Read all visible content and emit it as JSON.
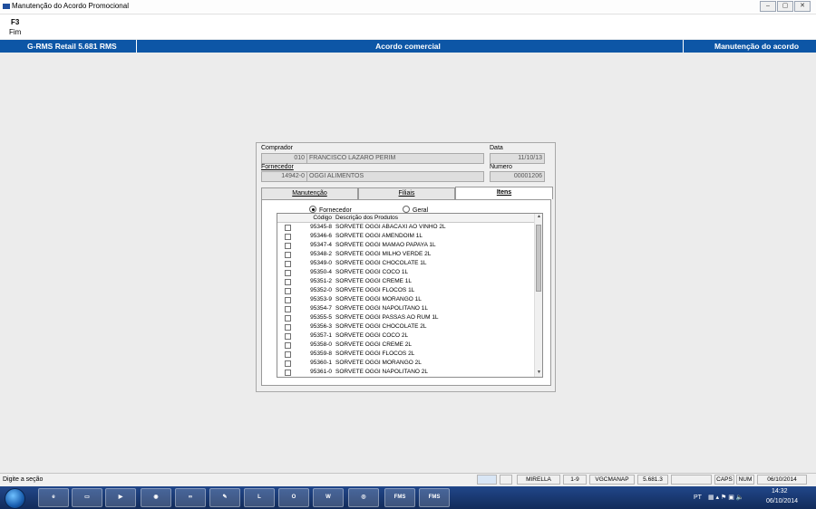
{
  "window": {
    "title": "Manutenção do Acordo Promocional",
    "controls": [
      "‒",
      "▢",
      "✕"
    ]
  },
  "toolbar": {
    "key": "F3",
    "action": "Fim"
  },
  "header": {
    "left": "G-RMS Retail 5.681 RMS",
    "center": "Acordo comercial",
    "right": "Manutenção do acordo"
  },
  "form": {
    "comprador_label": "Comprador",
    "comprador_code": "010",
    "comprador_name": "FRANCISCO LAZARO PERIM",
    "data_label": "Data",
    "data_value": "11/10/13",
    "fornecedor_label": "Fornecedor",
    "fornecedor_code": "14942-0",
    "fornecedor_name": "OGGI ALIMENTOS",
    "numero_label": "Numero",
    "numero_value": "00001206"
  },
  "tabs": [
    {
      "label": "Manutenção",
      "active": false
    },
    {
      "label": "Filiais",
      "active": false
    },
    {
      "label": "Itens",
      "active": true
    }
  ],
  "filter": {
    "option1": "Fornecedor",
    "option2": "Geral",
    "selected": "Fornecedor"
  },
  "grid": {
    "col_code": "Código",
    "col_desc": "Descrição dos Produtos",
    "rows": [
      {
        "code": "95345-8",
        "desc": "SORVETE OGGI ABACAXI AO VINHO 2L"
      },
      {
        "code": "95346-6",
        "desc": "SORVETE OGGI AMENDOIM 1L"
      },
      {
        "code": "95347-4",
        "desc": "SORVETE OGGI MAMAO PAPAYA 1L"
      },
      {
        "code": "95348-2",
        "desc": "SORVETE OGGI MILHO VERDE 2L"
      },
      {
        "code": "95349-0",
        "desc": "SORVETE OGGI CHOCOLATE 1L"
      },
      {
        "code": "95350-4",
        "desc": "SORVETE OGGI COCO 1L"
      },
      {
        "code": "95351-2",
        "desc": "SORVETE OGGI CREME 1L"
      },
      {
        "code": "95352-0",
        "desc": "SORVETE OGGI FLOCOS 1L"
      },
      {
        "code": "95353-9",
        "desc": "SORVETE OGGI MORANGO 1L"
      },
      {
        "code": "95354-7",
        "desc": "SORVETE OGGI NAPOLITANO 1L"
      },
      {
        "code": "95355-5",
        "desc": "SORVETE OGGI PASSAS AO RUM 1L"
      },
      {
        "code": "95356-3",
        "desc": "SORVETE OGGI CHOCOLATE 2L"
      },
      {
        "code": "95357-1",
        "desc": "SORVETE OGGI COCO 2L"
      },
      {
        "code": "95358-0",
        "desc": "SORVETE OGGI CREME 2L"
      },
      {
        "code": "95359-8",
        "desc": "SORVETE OGGI FLOCOS 2L"
      },
      {
        "code": "95360-1",
        "desc": "SORVETE OGGI MORANGO 2L"
      },
      {
        "code": "95361-0",
        "desc": "SORVETE OGGI NAPOLITANO 2L"
      }
    ]
  },
  "status": {
    "message": "Digite a seção",
    "user": "MIRELLA",
    "range": "1-9",
    "program": "VGCMANAP",
    "version": "5.681.3",
    "caps": "CAPS",
    "num": "NUM",
    "date": "06/10/2014"
  },
  "taskbar": {
    "fms1": "FMS",
    "fms2": "FMS",
    "lang": "PT",
    "time": "14:32",
    "date": "06/10/2014"
  }
}
